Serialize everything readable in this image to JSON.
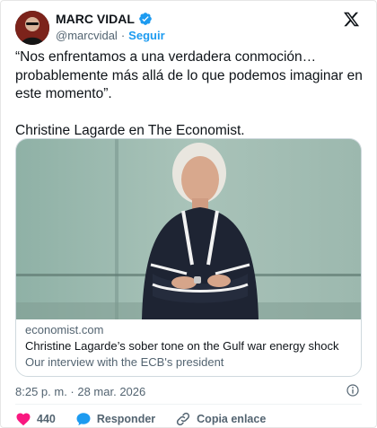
{
  "author": {
    "name": "MARC VIDAL",
    "handle": "@marcvidal",
    "separator": "·",
    "follow_label": "Seguir"
  },
  "tweet": {
    "paragraph1": "“Nos enfrentamos a una verdadera conmoción… probablemente más allá de lo que podemos imaginar en este momento”.",
    "paragraph2": "Christine Lagarde en The Economist."
  },
  "link_card": {
    "domain": "economist.com",
    "title": "Christine Lagarde’s sober tone on the Gulf war energy shock",
    "description": "Our interview with the ECB's president"
  },
  "timestamp": "8:25 p. m. · 28 mar. 2026",
  "actions": {
    "likes": "440",
    "reply_label": "Responder",
    "copy_label": "Copia enlace"
  },
  "colors": {
    "accent": "#1d9bf0",
    "like": "#f91880",
    "muted": "#536471"
  },
  "icons": [
    "verified-badge-icon",
    "x-logo-icon",
    "info-icon",
    "heart-icon",
    "reply-bubble-icon",
    "link-icon"
  ]
}
